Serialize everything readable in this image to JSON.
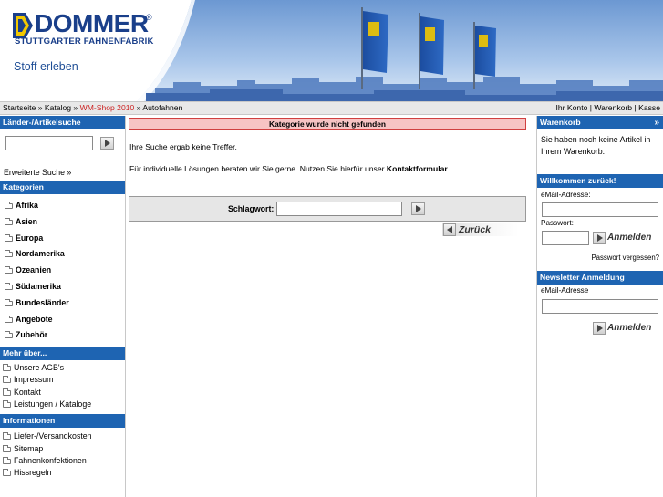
{
  "header": {
    "logo_text": "DOMMER",
    "logo_reg": "®",
    "logo_sub": "STUTTGARTER FAHNENFABRIK",
    "slogan": "Stoff erleben"
  },
  "breadcrumb": {
    "items": [
      "Startseite",
      "Katalog",
      "WM-Shop 2010",
      "Autofahnen"
    ],
    "separator": " » "
  },
  "top_links": {
    "account": "Ihr Konto",
    "cart": "Warenkorb",
    "checkout": "Kasse",
    "separator": " | "
  },
  "left": {
    "search_title": "Länder-/Artikelsuche",
    "advanced_search": "Erweiterte Suche »",
    "categories_title": "Kategorien",
    "categories": [
      "Afrika",
      "Asien",
      "Europa",
      "Nordamerika",
      "Ozeanien",
      "Südamerika",
      "Bundesländer",
      "Angebote",
      "Zubehör"
    ],
    "more_title": "Mehr über...",
    "more_items": [
      "Unsere AGB's",
      "Impressum",
      "Kontakt",
      "Leistungen / Kataloge"
    ],
    "info_title": "Informationen",
    "info_items": [
      "Liefer-/Versandkosten",
      "Sitemap",
      "Fahnenkonfektionen",
      "Hissregeln"
    ]
  },
  "main": {
    "error": "Kategorie wurde nicht gefunden",
    "no_hits": "Ihre Suche ergab keine Treffer.",
    "contact_text": "Für individuelle Lösungen beraten wir Sie gerne. Nutzen Sie hierfür unser ",
    "contact_link": "Kontaktformular",
    "keyword_label": "Schlagwort:",
    "keyword_value": "",
    "back_label": "Zurück"
  },
  "right": {
    "cart_title": "Warenkorb",
    "cart_arrow": "»",
    "cart_empty": "Sie haben noch keine Artikel in Ihrem Warenkorb.",
    "welcome_title": "Willkommen zurück!",
    "email_label": "eMail-Adresse:",
    "password_label": "Passwort:",
    "login_label": "Anmelden",
    "forgot_password": "Passwort vergessen?",
    "newsletter_title": "Newsletter Anmeldung",
    "newsletter_email_label": "eMail-Adresse",
    "newsletter_button": "Anmelden"
  },
  "colors": {
    "brand_blue": "#1a3f8a",
    "box_head_blue": "#1e64b2",
    "error_bg": "#f7c4c4",
    "breadcrumb_highlight": "#cc2222"
  }
}
